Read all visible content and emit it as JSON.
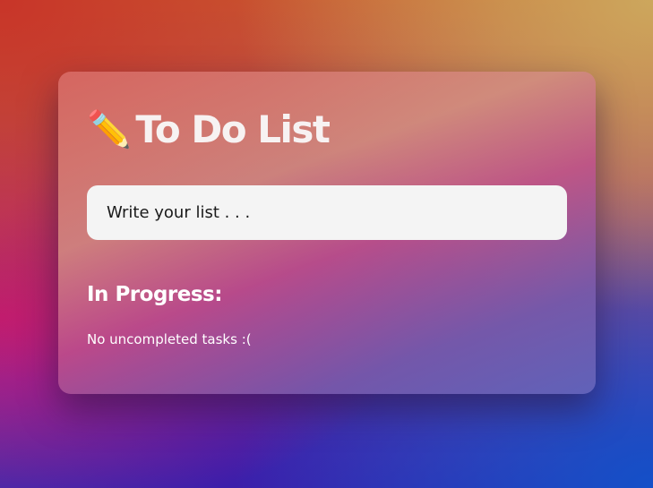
{
  "app": {
    "title_icon": "✏️",
    "title": "To Do List"
  },
  "input": {
    "placeholder": "Write your list . . ."
  },
  "in_progress": {
    "heading": "In Progress:",
    "empty_message": "No uncompleted tasks :("
  }
}
